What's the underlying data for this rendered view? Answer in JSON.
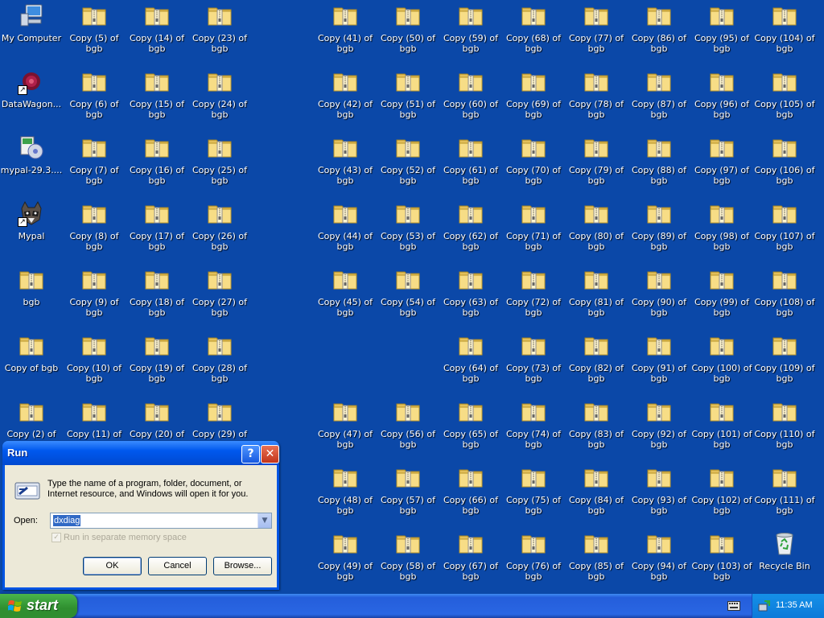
{
  "desktop": {
    "icons": [
      {
        "label": "My Computer",
        "icon": "my-computer-icon",
        "col": 0,
        "row": 0
      },
      {
        "label": "DataWagon...",
        "icon": "datawagon-icon",
        "col": 0,
        "row": 1,
        "shortcut": true
      },
      {
        "label": "mypal-29.3....",
        "icon": "installer-icon",
        "col": 0,
        "row": 2
      },
      {
        "label": "Mypal",
        "icon": "mypal-raccoon-icon",
        "col": 0,
        "row": 3,
        "shortcut": true
      },
      {
        "label": "bgb",
        "icon": "zip-folder-icon",
        "col": 0,
        "row": 4
      },
      {
        "label": "Copy of bgb",
        "icon": "zip-folder-icon",
        "col": 0,
        "row": 5
      },
      {
        "label": "Copy (2) of bgb",
        "icon": "zip-folder-icon",
        "col": 0,
        "row": 6
      },
      {
        "label": "Copy (5) of bgb",
        "icon": "zip-folder-icon",
        "col": 1,
        "row": 0
      },
      {
        "label": "Copy (6) of bgb",
        "icon": "zip-folder-icon",
        "col": 1,
        "row": 1
      },
      {
        "label": "Copy (7) of bgb",
        "icon": "zip-folder-icon",
        "col": 1,
        "row": 2
      },
      {
        "label": "Copy (8) of bgb",
        "icon": "zip-folder-icon",
        "col": 1,
        "row": 3
      },
      {
        "label": "Copy (9) of bgb",
        "icon": "zip-folder-icon",
        "col": 1,
        "row": 4
      },
      {
        "label": "Copy (10) of bgb",
        "icon": "zip-folder-icon",
        "col": 1,
        "row": 5
      },
      {
        "label": "Copy (11) of bgb",
        "icon": "zip-folder-icon",
        "col": 1,
        "row": 6
      },
      {
        "label": "Copy (14) of bgb",
        "icon": "zip-folder-icon",
        "col": 2,
        "row": 0
      },
      {
        "label": "Copy (15) of bgb",
        "icon": "zip-folder-icon",
        "col": 2,
        "row": 1
      },
      {
        "label": "Copy (16) of bgb",
        "icon": "zip-folder-icon",
        "col": 2,
        "row": 2
      },
      {
        "label": "Copy (17) of bgb",
        "icon": "zip-folder-icon",
        "col": 2,
        "row": 3
      },
      {
        "label": "Copy (18) of bgb",
        "icon": "zip-folder-icon",
        "col": 2,
        "row": 4
      },
      {
        "label": "Copy (19) of bgb",
        "icon": "zip-folder-icon",
        "col": 2,
        "row": 5
      },
      {
        "label": "Copy (20) of bgb",
        "icon": "zip-folder-icon",
        "col": 2,
        "row": 6
      },
      {
        "label": "Copy (23) of bgb",
        "icon": "zip-folder-icon",
        "col": 3,
        "row": 0
      },
      {
        "label": "Copy (24) of bgb",
        "icon": "zip-folder-icon",
        "col": 3,
        "row": 1
      },
      {
        "label": "Copy (25) of bgb",
        "icon": "zip-folder-icon",
        "col": 3,
        "row": 2
      },
      {
        "label": "Copy (26) of bgb",
        "icon": "zip-folder-icon",
        "col": 3,
        "row": 3
      },
      {
        "label": "Copy (27) of bgb",
        "icon": "zip-folder-icon",
        "col": 3,
        "row": 4
      },
      {
        "label": "Copy (28) of bgb",
        "icon": "zip-folder-icon",
        "col": 3,
        "row": 5
      },
      {
        "label": "Copy (29) of bgb",
        "icon": "zip-folder-icon",
        "col": 3,
        "row": 6
      },
      {
        "label": "Copy (41) of bgb",
        "icon": "zip-folder-icon",
        "col": 5,
        "row": 0
      },
      {
        "label": "Copy (42) of bgb",
        "icon": "zip-folder-icon",
        "col": 5,
        "row": 1
      },
      {
        "label": "Copy (43) of bgb",
        "icon": "zip-folder-icon",
        "col": 5,
        "row": 2
      },
      {
        "label": "Copy (44) of bgb",
        "icon": "zip-folder-icon",
        "col": 5,
        "row": 3
      },
      {
        "label": "Copy (45) of bgb",
        "icon": "zip-folder-icon",
        "col": 5,
        "row": 4
      },
      {
        "label": "Copy (47) of bgb",
        "icon": "zip-folder-icon",
        "col": 5,
        "row": 6
      },
      {
        "label": "Copy (48) of bgb",
        "icon": "zip-folder-icon",
        "col": 5,
        "row": 7
      },
      {
        "label": "Copy (49) of bgb",
        "icon": "zip-folder-icon",
        "col": 5,
        "row": 8
      },
      {
        "label": "Copy (50) of bgb",
        "icon": "zip-folder-icon",
        "col": 6,
        "row": 0
      },
      {
        "label": "Copy (51) of bgb",
        "icon": "zip-folder-icon",
        "col": 6,
        "row": 1
      },
      {
        "label": "Copy (52) of bgb",
        "icon": "zip-folder-icon",
        "col": 6,
        "row": 2
      },
      {
        "label": "Copy (53) of bgb",
        "icon": "zip-folder-icon",
        "col": 6,
        "row": 3
      },
      {
        "label": "Copy (54) of bgb",
        "icon": "zip-folder-icon",
        "col": 6,
        "row": 4
      },
      {
        "label": "Copy (56) of bgb",
        "icon": "zip-folder-icon",
        "col": 6,
        "row": 6
      },
      {
        "label": "Copy (57) of bgb",
        "icon": "zip-folder-icon",
        "col": 6,
        "row": 7
      },
      {
        "label": "Copy (58) of bgb",
        "icon": "zip-folder-icon",
        "col": 6,
        "row": 8
      },
      {
        "label": "Copy (59) of bgb",
        "icon": "zip-folder-icon",
        "col": 7,
        "row": 0
      },
      {
        "label": "Copy (60) of bgb",
        "icon": "zip-folder-icon",
        "col": 7,
        "row": 1
      },
      {
        "label": "Copy (61) of bgb",
        "icon": "zip-folder-icon",
        "col": 7,
        "row": 2
      },
      {
        "label": "Copy (62) of bgb",
        "icon": "zip-folder-icon",
        "col": 7,
        "row": 3
      },
      {
        "label": "Copy (63) of bgb",
        "icon": "zip-folder-icon",
        "col": 7,
        "row": 4
      },
      {
        "label": "Copy (64) of bgb",
        "icon": "zip-folder-icon",
        "col": 7,
        "row": 5
      },
      {
        "label": "Copy (65) of bgb",
        "icon": "zip-folder-icon",
        "col": 7,
        "row": 6
      },
      {
        "label": "Copy (66) of bgb",
        "icon": "zip-folder-icon",
        "col": 7,
        "row": 7
      },
      {
        "label": "Copy (67) of bgb",
        "icon": "zip-folder-icon",
        "col": 7,
        "row": 8
      },
      {
        "label": "Copy (68) of bgb",
        "icon": "zip-folder-icon",
        "col": 8,
        "row": 0
      },
      {
        "label": "Copy (69) of bgb",
        "icon": "zip-folder-icon",
        "col": 8,
        "row": 1
      },
      {
        "label": "Copy (70) of bgb",
        "icon": "zip-folder-icon",
        "col": 8,
        "row": 2
      },
      {
        "label": "Copy (71) of bgb",
        "icon": "zip-folder-icon",
        "col": 8,
        "row": 3
      },
      {
        "label": "Copy (72) of bgb",
        "icon": "zip-folder-icon",
        "col": 8,
        "row": 4
      },
      {
        "label": "Copy (73) of bgb",
        "icon": "zip-folder-icon",
        "col": 8,
        "row": 5
      },
      {
        "label": "Copy (74) of bgb",
        "icon": "zip-folder-icon",
        "col": 8,
        "row": 6
      },
      {
        "label": "Copy (75) of bgb",
        "icon": "zip-folder-icon",
        "col": 8,
        "row": 7
      },
      {
        "label": "Copy (76) of bgb",
        "icon": "zip-folder-icon",
        "col": 8,
        "row": 8
      },
      {
        "label": "Copy (77) of bgb",
        "icon": "zip-folder-icon",
        "col": 9,
        "row": 0
      },
      {
        "label": "Copy (78) of bgb",
        "icon": "zip-folder-icon",
        "col": 9,
        "row": 1
      },
      {
        "label": "Copy (79) of bgb",
        "icon": "zip-folder-icon",
        "col": 9,
        "row": 2
      },
      {
        "label": "Copy (80) of bgb",
        "icon": "zip-folder-icon",
        "col": 9,
        "row": 3
      },
      {
        "label": "Copy (81) of bgb",
        "icon": "zip-folder-icon",
        "col": 9,
        "row": 4
      },
      {
        "label": "Copy (82) of bgb",
        "icon": "zip-folder-icon",
        "col": 9,
        "row": 5
      },
      {
        "label": "Copy (83) of bgb",
        "icon": "zip-folder-icon",
        "col": 9,
        "row": 6
      },
      {
        "label": "Copy (84) of bgb",
        "icon": "zip-folder-icon",
        "col": 9,
        "row": 7
      },
      {
        "label": "Copy (85) of bgb",
        "icon": "zip-folder-icon",
        "col": 9,
        "row": 8
      },
      {
        "label": "Copy (86) of bgb",
        "icon": "zip-folder-icon",
        "col": 10,
        "row": 0
      },
      {
        "label": "Copy (87) of bgb",
        "icon": "zip-folder-icon",
        "col": 10,
        "row": 1
      },
      {
        "label": "Copy (88) of bgb",
        "icon": "zip-folder-icon",
        "col": 10,
        "row": 2
      },
      {
        "label": "Copy (89) of bgb",
        "icon": "zip-folder-icon",
        "col": 10,
        "row": 3
      },
      {
        "label": "Copy (90) of bgb",
        "icon": "zip-folder-icon",
        "col": 10,
        "row": 4
      },
      {
        "label": "Copy (91) of bgb",
        "icon": "zip-folder-icon",
        "col": 10,
        "row": 5
      },
      {
        "label": "Copy (92) of bgb",
        "icon": "zip-folder-icon",
        "col": 10,
        "row": 6
      },
      {
        "label": "Copy (93) of bgb",
        "icon": "zip-folder-icon",
        "col": 10,
        "row": 7
      },
      {
        "label": "Copy (94) of bgb",
        "icon": "zip-folder-icon",
        "col": 10,
        "row": 8
      },
      {
        "label": "Copy (95) of bgb",
        "icon": "zip-folder-icon",
        "col": 11,
        "row": 0
      },
      {
        "label": "Copy (96) of bgb",
        "icon": "zip-folder-icon",
        "col": 11,
        "row": 1
      },
      {
        "label": "Copy (97) of bgb",
        "icon": "zip-folder-icon",
        "col": 11,
        "row": 2
      },
      {
        "label": "Copy (98) of bgb",
        "icon": "zip-folder-icon",
        "col": 11,
        "row": 3
      },
      {
        "label": "Copy (99) of bgb",
        "icon": "zip-folder-icon",
        "col": 11,
        "row": 4
      },
      {
        "label": "Copy (100) of bgb",
        "icon": "zip-folder-icon",
        "col": 11,
        "row": 5
      },
      {
        "label": "Copy (101) of bgb",
        "icon": "zip-folder-icon",
        "col": 11,
        "row": 6
      },
      {
        "label": "Copy (102) of bgb",
        "icon": "zip-folder-icon",
        "col": 11,
        "row": 7
      },
      {
        "label": "Copy (103) of bgb",
        "icon": "zip-folder-icon",
        "col": 11,
        "row": 8
      },
      {
        "label": "Copy (104) of bgb",
        "icon": "zip-folder-icon",
        "col": 12,
        "row": 0
      },
      {
        "label": "Copy (105) of bgb",
        "icon": "zip-folder-icon",
        "col": 12,
        "row": 1
      },
      {
        "label": "Copy (106) of bgb",
        "icon": "zip-folder-icon",
        "col": 12,
        "row": 2
      },
      {
        "label": "Copy (107) of bgb",
        "icon": "zip-folder-icon",
        "col": 12,
        "row": 3
      },
      {
        "label": "Copy (108) of bgb",
        "icon": "zip-folder-icon",
        "col": 12,
        "row": 4
      },
      {
        "label": "Copy (109) of bgb",
        "icon": "zip-folder-icon",
        "col": 12,
        "row": 5
      },
      {
        "label": "Copy (110) of bgb",
        "icon": "zip-folder-icon",
        "col": 12,
        "row": 6
      },
      {
        "label": "Copy (111) of bgb",
        "icon": "zip-folder-icon",
        "col": 12,
        "row": 7
      },
      {
        "label": "Recycle Bin",
        "icon": "recycle-bin-icon",
        "col": 12,
        "row": 8
      }
    ]
  },
  "run_dialog": {
    "title": "Run",
    "help_glyph": "?",
    "close_glyph": "✕",
    "description": "Type the name of a program, folder, document, or Internet resource, and Windows will open it for you.",
    "open_label": "Open:",
    "open_value": "dxdiag",
    "separate_memory_label": "Run in separate memory space",
    "separate_memory_checked": true,
    "ok_label": "OK",
    "cancel_label": "Cancel",
    "browse_label": "Browse..."
  },
  "taskbar": {
    "start_label": "start",
    "clock": "11:35 AM"
  },
  "colors": {
    "desktop_background": "#0b48a8",
    "taskbar_blue": "#245edb",
    "start_green": "#3c9a3c",
    "dialog_face": "#ece9d8",
    "selection": "#316ac5"
  }
}
